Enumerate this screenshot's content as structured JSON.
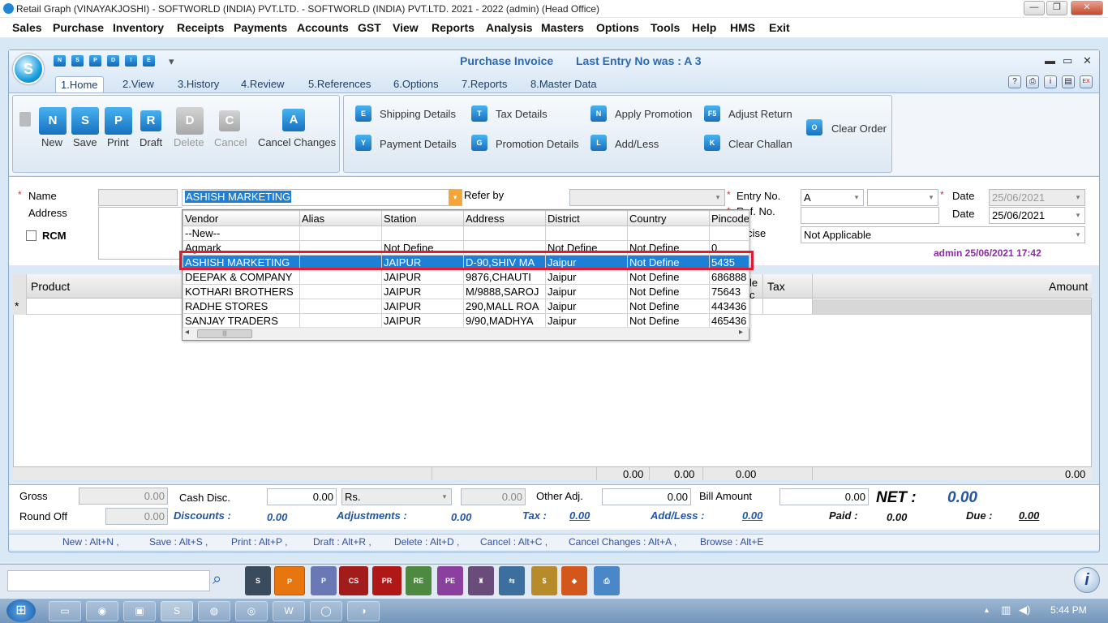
{
  "window": {
    "title": "Retail Graph (VINAYAKJOSHI) - SOFTWORLD (INDIA) PVT.LTD. - SOFTWORLD (INDIA) PVT.LTD.  2021 - 2022 (admin) (Head Office)",
    "minimize": "—",
    "restore": "❐",
    "close": "✕"
  },
  "menu": [
    "Sales",
    "Purchase",
    "Inventory",
    "Receipts",
    "Payments",
    "Accounts",
    "GST",
    "View",
    "Reports",
    "Analysis",
    "Masters",
    "Options",
    "Tools",
    "Help",
    "HMS",
    "Exit"
  ],
  "app": {
    "logo": "S",
    "quick_access": [
      "N",
      "S",
      "P",
      "D",
      "I",
      "E"
    ],
    "qa_dropdown": "▾",
    "title": "Purchase Invoice",
    "last_entry": "Last Entry No was : A 3",
    "controls": {
      "min": "▬",
      "max": "▭",
      "close": "✕"
    }
  },
  "tabs": [
    "1.Home",
    "2.View",
    "3.History",
    "4.Review",
    "5.References",
    "6.Options",
    "7.Reports",
    "8.Master Data"
  ],
  "ribbon_icons": [
    "?",
    "⎙",
    "i",
    "▤",
    "EX"
  ],
  "ribbon": {
    "main": [
      {
        "icon": "N",
        "label": "New",
        "disabled": false
      },
      {
        "icon": "S",
        "label": "Save",
        "disabled": false
      },
      {
        "icon": "P",
        "label": "Print",
        "disabled": false
      },
      {
        "icon": "R",
        "label": "Draft",
        "disabled": false
      },
      {
        "icon": "D",
        "label": "Delete",
        "disabled": true
      },
      {
        "icon": "C",
        "label": "Cancel",
        "disabled": true
      },
      {
        "icon": "A",
        "label": "Cancel Changes",
        "disabled": false
      }
    ],
    "actions": [
      {
        "icon": "E",
        "label": "Shipping Details"
      },
      {
        "icon": "Y",
        "label": "Payment Details"
      },
      {
        "icon": "T",
        "label": "Tax Details"
      },
      {
        "icon": "G",
        "label": "Promotion Details"
      },
      {
        "icon": "N",
        "label": "Apply Promotion"
      },
      {
        "icon": "L",
        "label": "Add/Less"
      },
      {
        "icon": "F5",
        "label": "Adjust Return"
      },
      {
        "icon": "K",
        "label": "Clear Challan"
      },
      {
        "icon": "O",
        "label": "Clear Order"
      }
    ]
  },
  "form": {
    "name_label": "Name",
    "address_label": "Address",
    "rcm_label": "RCM",
    "name_value": "ASHISH MARKETING",
    "referby_label": "Refer by",
    "entryno_label": "Entry No.",
    "entryno_value": "A",
    "refno_label": "Ref. No.",
    "date_label": "Date",
    "date1": "25/06/2021",
    "date2": "25/06/2021",
    "excise_label": "Excise",
    "excise_value": "Not Applicable",
    "admin_stamp": "admin 25/06/2021 17:42",
    "required_mark": "*",
    "arrow": "▾"
  },
  "dropdown": {
    "columns": [
      "Vendor",
      "Alias",
      "Station",
      "Address",
      "District",
      "Country",
      "Pincode"
    ],
    "rows": [
      [
        "--New--",
        "",
        "",
        "",
        "",
        "",
        ""
      ],
      [
        "Agmark",
        "",
        "Not Define",
        "",
        "Not Define",
        "Not Define",
        "0"
      ],
      [
        "ASHISH MARKETING",
        "",
        "JAIPUR",
        "D-90,SHIV MA",
        "Jaipur",
        "Not Define",
        "5435"
      ],
      [
        "DEEPAK & COMPANY",
        "",
        "JAIPUR",
        "9876,CHAUTI",
        "Jaipur",
        "Not Define",
        "686888"
      ],
      [
        "KOTHARI BROTHERS",
        "",
        "JAIPUR",
        "M/9888,SAROJ",
        "Jaipur",
        "Not Define",
        "75643"
      ],
      [
        "RADHE STORES",
        "",
        "JAIPUR",
        "290,MALL ROA",
        "Jaipur",
        "Not Define",
        "443436"
      ],
      [
        "SANJAY TRADERS",
        "",
        "JAIPUR",
        "9/90,MADHYA",
        "Jaipur",
        "Not Define",
        "465436"
      ]
    ],
    "selected_index": 2,
    "scroll_left": "◂",
    "scroll_right": "▸",
    "thumb": "|||"
  },
  "grid": {
    "product_header": "Product",
    "tax_header": "Tax",
    "amount_header": "Amount",
    "hidden_header": "le",
    "hidden_header_2": "c",
    "new_row_marker": "*",
    "totals": [
      "0.00",
      "0.00",
      "0.00",
      "0.00"
    ]
  },
  "footer": {
    "gross_label": "Gross",
    "gross_value": "0.00",
    "cashdisc_label": "Cash Disc.",
    "cashdisc_value": "0.00",
    "cashdisc_type": "Rs.",
    "cashdisc_amount": "0.00",
    "otheradj_label": "Other Adj.",
    "otheradj_value": "0.00",
    "billamount_label": "Bill Amount",
    "billamount_value": "0.00",
    "net_label": "NET :",
    "net_value": "0.00",
    "roundoff_label": "Round Off",
    "roundoff_value": "0.00",
    "discounts_label": "Discounts :",
    "discounts_value": "0.00",
    "adjustments_label": "Adjustments :",
    "adjustments_value": "0.00",
    "tax_label": "Tax :",
    "tax_value": "0.00",
    "addless_label": "Add/Less :",
    "addless_value": "0.00",
    "paid_label": "Paid :",
    "paid_value": "0.00",
    "due_label": "Due :",
    "due_value": "0.00"
  },
  "shortcuts": [
    "New : Alt+N ,",
    "Save : Alt+S ,",
    "Print : Alt+P ,",
    "Draft : Alt+R ,",
    "Delete : Alt+D ,",
    "Cancel : Alt+C ,",
    "Cancel Changes : Alt+A ,",
    "Browse : Alt+E"
  ],
  "bottombar": {
    "search_icon": "⌕",
    "tools": [
      "S",
      "P",
      "P",
      "CS",
      "PR",
      "RE",
      "PE",
      "♜",
      "⇆",
      "$",
      "◆",
      "⎙"
    ],
    "info": "i"
  },
  "taskbar": {
    "start": "⊞",
    "apps": [
      "▭",
      "◉",
      "▣",
      "S",
      "◍",
      "◎",
      "W",
      "◯",
      "◑"
    ],
    "tray_arrow": "▲",
    "tray_icons": [
      "▥",
      "◀)"
    ],
    "clock": "5:44 PM"
  }
}
